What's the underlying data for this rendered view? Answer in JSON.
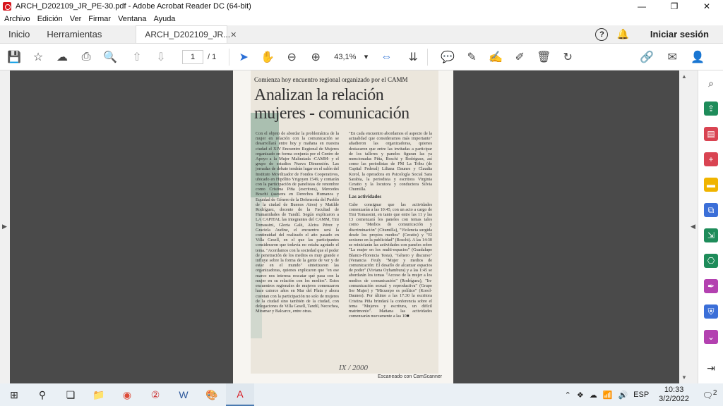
{
  "window": {
    "title": "ARCH_D202109_JR_PE-30.pdf - Adobe Acrobat Reader DC (64-bit)",
    "controls": [
      "—",
      "❐",
      "✕"
    ]
  },
  "menu": [
    "Archivo",
    "Edición",
    "Ver",
    "Firmar",
    "Ventana",
    "Ayuda"
  ],
  "tabs": {
    "home": "Inicio",
    "tools": "Herramientas",
    "document": "ARCH_D202109_JR...",
    "close": "✕"
  },
  "header_right": {
    "help": "?",
    "signin": "Iniciar sesión"
  },
  "toolbar": {
    "page_current": "1",
    "page_total": "/ 1",
    "zoom": "43,1%"
  },
  "document": {
    "kicker": "Comienza hoy encuentro regional organizado por el CAMM",
    "headline": "Analizan la relación mujeres - comunicación",
    "col_left": "Con el objeto de abordar la problemática de la mujer en relación con la comunicación se desarrollará entre hoy y mañana en nuestra ciudad el XIV Encuentro Regional de Mujeres organizado en forma conjunta por el Centro de Apoyo a la Mujer Maltratada -CAMM- y el grupo de estudios Nueva Dimensión. Las jornadas de debate tendrán lugar en el salón del Instituto Movilizador de Fondos Cooperativos, ubicado en Hipólito Yrigoyen 1549, y contarán con la participación de panelistas de renombre como Cristina Piña (escritora), Mercedes Boschi (asesora en Derechos Humanos y Equidad de Género de la Defensoría del Pueblo de la ciudad de Buenos Aires) y Matilde Rodríguez, docente de la Facultad de Humanidades de Tandil. Según explicaron a LA CAPITAL las integrantes del CAMM, Tini Tomassini, Gloria Galé, Alcira Pérez y Graciela Audine, el encuentro será la continuidad del realizado el año pasado en Villa Gesell, en el que las participantes consideraron que todavía no estaba agotado el tema. \"Acordamos con la sociedad que el poder de penetración de los medios es muy grande e influye sobre la forma de la gente de ver y de estar en el mundo\" sintetizaron las organizadoras, quienes explicaron que \"en ese marco nos interesa rescatar qué pasa con la mujer en su relación con los medios\". Estos encuentros regionales de mujeres comenzaron hace catorce años en Mar del Plata y ahora cuentan con la participación no solo de mujeres de la ciudad sino también de la ciudad, con delegaciones de Villa Gesell, Tandil, Necochea, Miramar y Balcarce, entre otras.",
    "col_right_1": "\"En cada encuentro abordamos el aspecto de la actualidad que consideramos más importante\" añadieron las organizadoras, quienes destacaron que entre las invitadas a participar de los talleres y paneles figuran las ya mencionadas Piña, Boschi y Rodríguez, así como las periodistas de FM La Tribu (de Capital Federal) Liliana Daunes y Claudia Korol, la operadora en Psicología Social Sara Sarabia, la periodista y escritora Virginia Ceratto y la locutora y conductora Silvia Chumilla.",
    "subhead": "Las actividades",
    "col_right_2": "Cabe consignar que las actividades comenzarán a las 10:45, con un acto a cargo de Tini Tomassini, en tanto que entre las 11 y las 13 comenzará los paneles con temas tales como \"Medios de comunicación y discriminación\" (Chumilla), \"Violencia surgida desde los propios medios\" (Ceratto) y \"El sexismo en la publicidad\" (Boschi). A las 14:30 se reiniciarán las actividades con paneles sobre \"La mujer en los multi-espacios\" (Guadalupe Blanco-Florencia Testa), \"Género y discurso\" (Venancia Feuly \"Mujer y medios de comunicación: El desafío de alcanzar espacios de poder\" (Viviana Oyhambura) y a las 1:45 se abordarán los temas \"Acceso de la mujer a los medios de comunicación\" (Rodríguez), \"In-comunicación sexual y reproductiva\" (Grupo Ser Mujer) y \"Micuerpo es político\" (Korol-Daunes). Por último a las 17:30 la escritora Cristina Piña brindará la conferencia sobre el tema \"Mujeres y escritura, un difícil matrimonio\". Mañana las actividades comenzarán nuevamente a las 10■",
    "signature": "IX / 2000",
    "scanner": "Escaneado con CamScanner"
  },
  "taskbar": {
    "language": "ESP",
    "time": "10:33",
    "date": "3/2/2022",
    "notifications": "2"
  }
}
